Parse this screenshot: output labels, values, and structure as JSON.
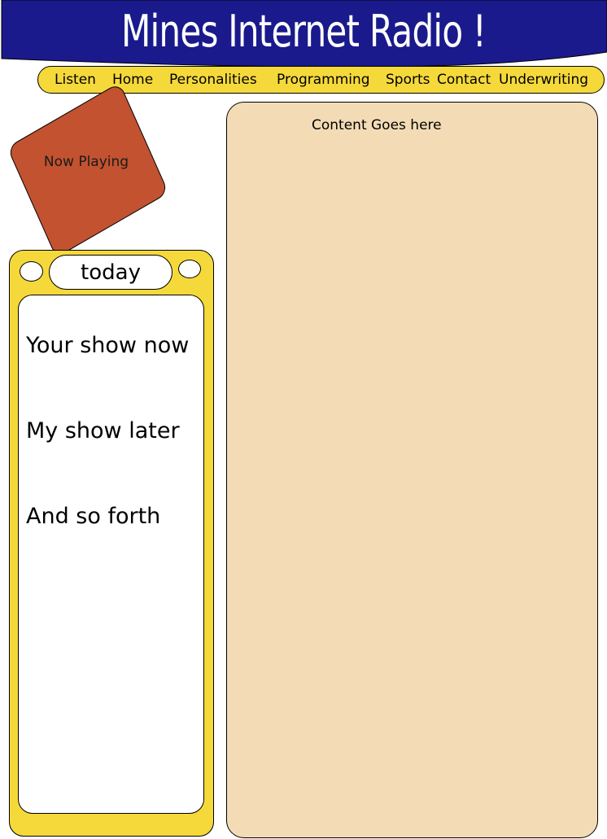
{
  "header": {
    "title": "Mines Internet Radio !"
  },
  "nav": {
    "items": [
      {
        "label": "Listen"
      },
      {
        "label": "Home"
      },
      {
        "label": "Personalities"
      },
      {
        "label": "Programming"
      },
      {
        "label": "Sports"
      },
      {
        "label": "Contact"
      },
      {
        "label": "Underwriting"
      }
    ]
  },
  "now_playing": {
    "label": "Now Playing"
  },
  "schedule": {
    "heading": "today",
    "items": [
      {
        "label": "Your show now"
      },
      {
        "label": "My show later"
      },
      {
        "label": "And so forth"
      }
    ]
  },
  "content": {
    "text": "Content Goes here"
  },
  "colors": {
    "banner": "#1a1a8c",
    "nav": "#f5d93a",
    "now_playing": "#c25230",
    "content_bg": "#f3dcb5"
  }
}
